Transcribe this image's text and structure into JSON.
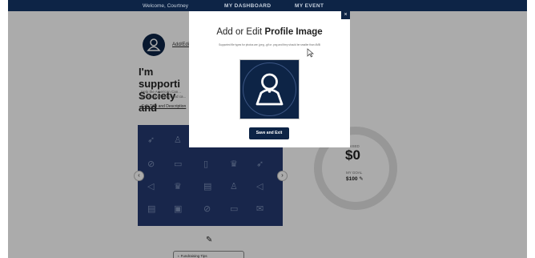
{
  "nav": {
    "welcome": "Welcome, Courtney",
    "dashboard": "MY DASHBOARD",
    "event": "MY EVENT"
  },
  "profile": {
    "add_link": "Add/Edit"
  },
  "campaign": {
    "headline_line1": "I'm supporti",
    "headline_line2": "Society and",
    "description": "Help the American Can... advocacy efforts to end ca...",
    "edit_link": "Edit Title and Description"
  },
  "progress": {
    "raised_label": "RAISED",
    "raised_value": "$0",
    "goal_label": "MY GOAL",
    "goal_value": "$100",
    "fraction_raised": 0
  },
  "tips": {
    "label": "Fundraising Tips"
  },
  "modal": {
    "title_prefix": "Add or Edit",
    "title_bold": "Profile Image",
    "note": "Supported file types for photos are .jpeg, .gif or .png and they should be smaller than 4MB",
    "save_label": "Save and Exit",
    "close_label": "×"
  },
  "colors": {
    "navy": "#0d2446",
    "grid": "#243a70",
    "ring": "#e2e2e2"
  }
}
